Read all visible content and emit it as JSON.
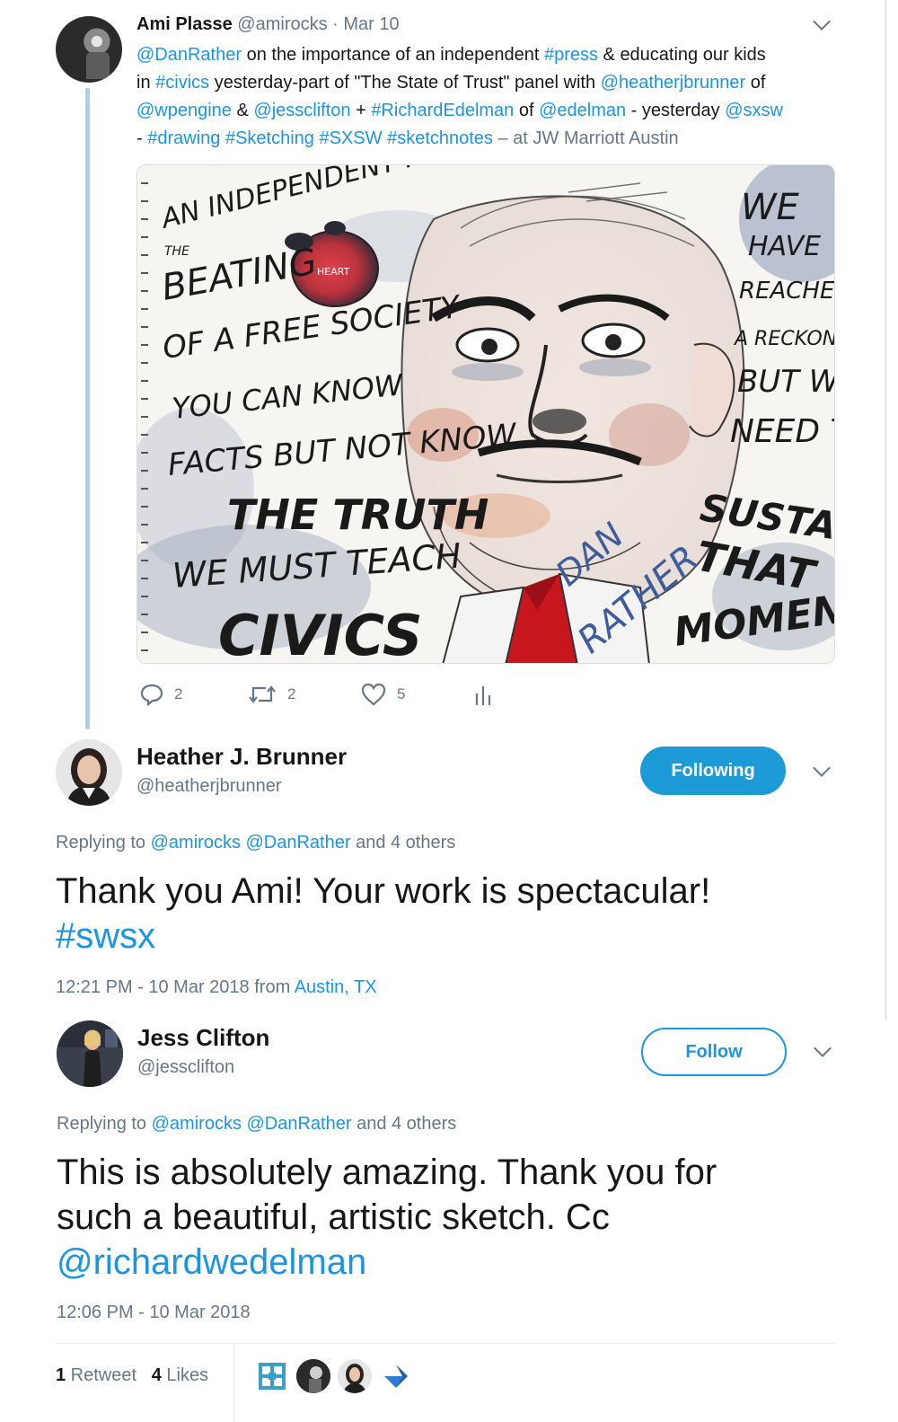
{
  "tweet": {
    "author_name": "Ami Plasse",
    "author_handle": "@amirocks",
    "separator": " · ",
    "date": "Mar 10",
    "lines": [
      [
        {
          "t": "@DanRather",
          "link": true
        },
        {
          "t": " on the importance of an independent "
        },
        {
          "t": "#press",
          "link": true
        },
        {
          "t": " & educating our kids"
        }
      ],
      [
        {
          "t": "in "
        },
        {
          "t": "#civics",
          "link": true
        },
        {
          "t": " yesterday-part of \"The State of Trust\" panel with "
        },
        {
          "t": "@heatherjbrunner",
          "link": true
        },
        {
          "t": " of"
        }
      ],
      [
        {
          "t": "@wpengine",
          "link": true
        },
        {
          "t": " & "
        },
        {
          "t": "@jessclifton",
          "link": true
        },
        {
          "t": " + "
        },
        {
          "t": "#RichardEdelman",
          "link": true
        },
        {
          "t": " of "
        },
        {
          "t": "@edelman",
          "link": true
        },
        {
          "t": " - yesterday "
        },
        {
          "t": "@sxsw",
          "link": true
        }
      ],
      [
        {
          "t": "- "
        },
        {
          "t": "#drawing",
          "link": true
        },
        {
          "t": " "
        },
        {
          "t": "#Sketching",
          "link": true
        },
        {
          "t": " "
        },
        {
          "t": "#SXSW",
          "link": true
        },
        {
          "t": " "
        },
        {
          "t": "#sketchnotes",
          "link": true
        },
        {
          "t": " – at JW Marriott Austin",
          "muted": true
        }
      ]
    ],
    "sketch_words": {
      "press": "AN INDEPENDENT PRESS",
      "the": "THE",
      "beating": "BEATING",
      "heart": "HEART",
      "free_society": "OF A FREE SOCIETY",
      "can_know": "YOU CAN KNOW",
      "facts": "FACTS BUT NOT KNOW",
      "truth": "THE TRUTH",
      "teach": "WE MUST TEACH",
      "civics": "CIVICS",
      "we_have": "WE",
      "have": "HAVE",
      "reached": "REACHED",
      "reckoning": "A RECKONING",
      "but_we": "BUT WE",
      "need_to": "NEED TO",
      "sustain": "SUSTAIN",
      "that": "THAT",
      "momentum": "MOMENTUM",
      "dan": "DAN",
      "rather": "RATHER"
    },
    "actions": {
      "replies": "2",
      "retweets": "2",
      "likes": "5"
    }
  },
  "reply1": {
    "name": "Heather J. Brunner",
    "handle": "@heatherjbrunner",
    "button": "Following",
    "replying_prefix": "Replying to ",
    "replying_users": "@amirocks @DanRather",
    "replying_suffix": " and 4 others",
    "text_line1": "Thank you Ami!   Your work is spectacular!",
    "hashtag": "#swsx",
    "time": "12:21 PM - 10 Mar 2018 from ",
    "location": "Austin, TX"
  },
  "reply2": {
    "name": "Jess Clifton",
    "handle": "@jessclifton",
    "button": "Follow",
    "replying_prefix": "Replying to ",
    "replying_users": "@amirocks @DanRather",
    "replying_suffix": " and 4 others",
    "text_line1": "This is absolutely amazing. Thank you for",
    "text_line2": "such a beautiful, artistic sketch. Cc",
    "mention": "@richardwedelman",
    "time": "12:06 PM - 10 Mar 2018",
    "retweet_count": "1",
    "retweet_label": " Retweet",
    "likes_count": "4",
    "likes_label": " Likes"
  },
  "colors": {
    "link": "#1b95e0",
    "muted": "#657786",
    "following_bg": "#1d9bd6",
    "thread": "#a5d2ef"
  },
  "icons": [
    "reply-icon",
    "retweet-icon",
    "heart-icon",
    "analytics-icon",
    "chevron-down-icon"
  ]
}
